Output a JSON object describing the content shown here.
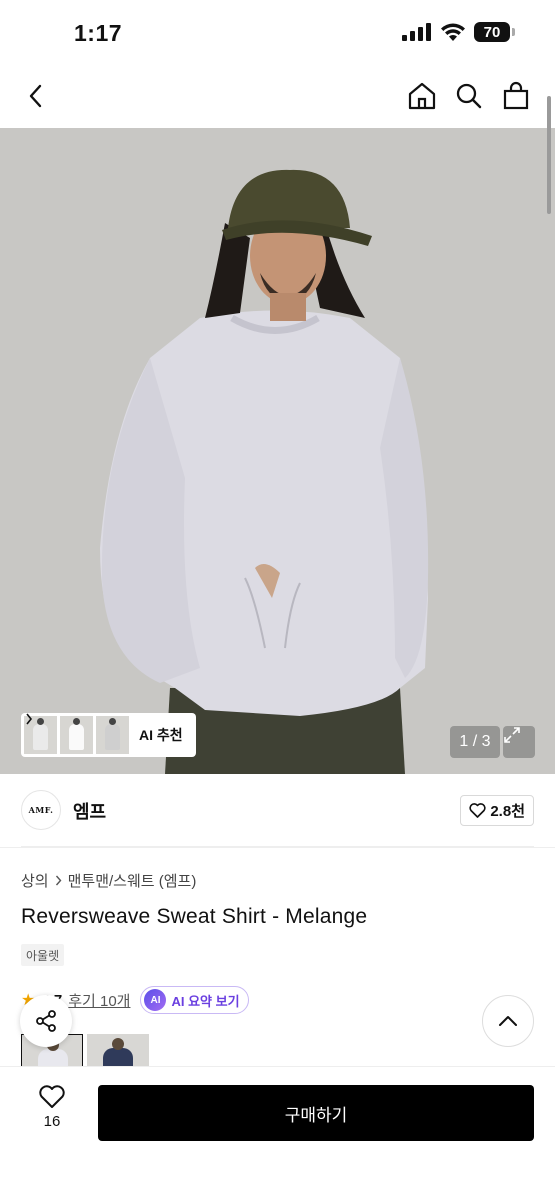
{
  "status_bar": {
    "time": "1:17",
    "battery": "70"
  },
  "nav": {
    "back_icon": "chevron-left-icon",
    "home_icon": "home-icon",
    "search_icon": "search-icon",
    "bag_icon": "shopping-bag-icon"
  },
  "gallery": {
    "ai_recommend_label": "AI 추천",
    "page_counter": "1 / 3",
    "expand_icon": "expand-icon"
  },
  "brand": {
    "logo_text": "AMF.",
    "name": "엠프",
    "like_count": "2.8천"
  },
  "breadcrumb": [
    "상의",
    "맨투맨/스웨트 (엠프)"
  ],
  "product": {
    "title": "Reversweave Sweat Shirt - Melange",
    "tag": "아울렛",
    "rating": "4.7",
    "review_link": "후기 10개",
    "ai_summary_badge": "AI",
    "ai_summary_label": "AI 요약 보기"
  },
  "bottom": {
    "wish_count": "16",
    "buy_label": "구매하기"
  },
  "colors": {
    "accent_purple": "#6a3fe0",
    "buy_button": "#000000",
    "star": "#f2a600"
  }
}
